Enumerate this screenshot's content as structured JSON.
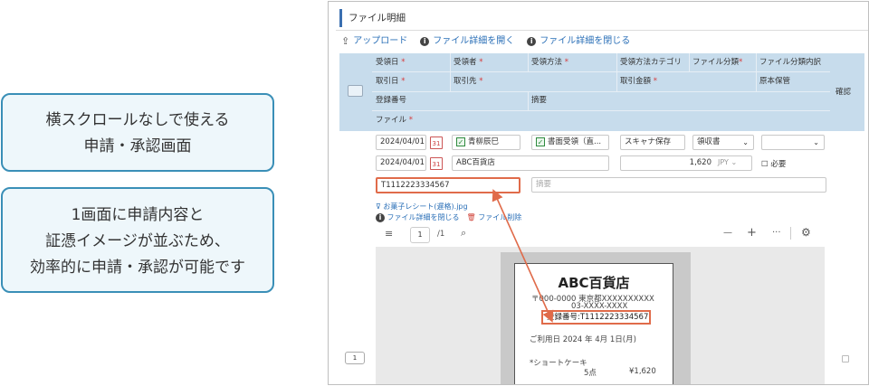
{
  "callouts": [
    {
      "lines": [
        "横スクロールなしで使える",
        "申請・承認画面"
      ]
    },
    {
      "lines": [
        "1画面に申請内容と",
        "証憑イメージが並ぶため、",
        "効率的に申請・承認が可能です"
      ]
    }
  ],
  "section_title": "ファイル明細",
  "toolbar": {
    "upload": "アップロード",
    "open_details": "ファイル詳細を開く",
    "close_details": "ファイル詳細を閉じる"
  },
  "header": {
    "row1": [
      "受領日",
      "受領者",
      "受領方法",
      "受領方法カテゴリ",
      "ファイル分類",
      "ファイル分類内訳"
    ],
    "row1_required": [
      true,
      true,
      true,
      false,
      true,
      false
    ],
    "row2": [
      "取引日",
      "取引先",
      "取引金額",
      "原本保管"
    ],
    "row2_required": [
      true,
      true,
      true,
      false
    ],
    "row3": [
      "登録番号",
      "摘要"
    ],
    "row4": "ファイル",
    "confirm": "確認"
  },
  "row": {
    "receipt_date": "2024/04/01",
    "receiver": "青柳辰巳",
    "receive_method": "書面受領（直...",
    "method_category": "スキャナ保存",
    "file_class": "領収書",
    "file_class_detail": "",
    "transaction_date": "2024/04/01",
    "partner": "ABC百貨店",
    "amount": "1,620",
    "currency": "JPY",
    "original_keep": "必要",
    "registration_no": "T1112223334567",
    "memo_placeholder": "摘要",
    "row_number": "1"
  },
  "attachment": {
    "file_name": "お菓子レシート(遅格).jpg",
    "close_details": "ファイル詳細を閉じる",
    "delete": "ファイル削除"
  },
  "pdf_viewer": {
    "page": "1",
    "total": "/1",
    "minus": "—",
    "plus": "+",
    "more": "···"
  },
  "receipt": {
    "store": "ABC百貨店",
    "address1": "〒000-0000  東京都XXXXXXXXXX",
    "address2": "03-XXXX-XXXX",
    "registration": "登録番号:T1112223334567",
    "use_date": "ご利用日  2024  年  4月  1日(月)",
    "item": "*ショートケーキ",
    "qty": "5点",
    "price": "¥1,620"
  },
  "colors": {
    "accent": "#3a8fb7",
    "header_bg": "#c7dcec",
    "highlight": "#e06b4a",
    "link": "#2a6fb7"
  }
}
